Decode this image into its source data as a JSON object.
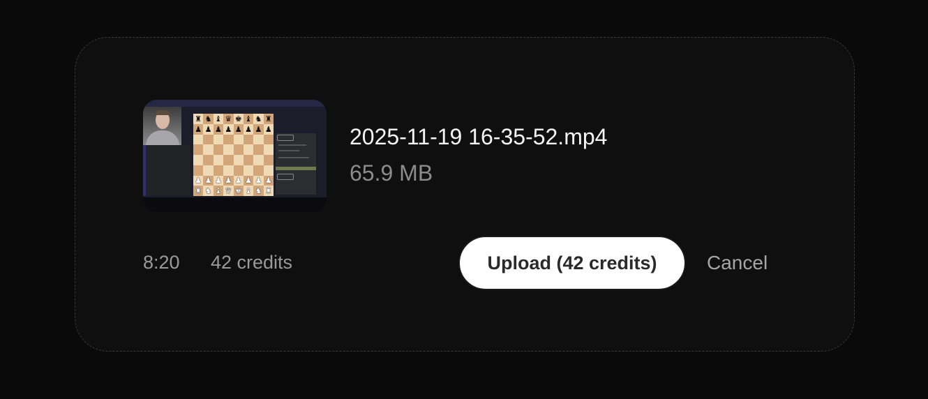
{
  "file": {
    "name": "2025-11-19 16-35-52.mp4",
    "size": "65.9 MB",
    "duration": "8:20",
    "credits": "42 credits",
    "thumbnail_icon": "chess-video-thumbnail"
  },
  "actions": {
    "upload_label": "Upload (42 credits)",
    "cancel_label": "Cancel"
  },
  "colors": {
    "background": "#0a0a0a",
    "card": "#0f0f0f",
    "primary_button_bg": "#ffffff",
    "primary_button_text": "#2a2a2a",
    "muted_text": "#9a9a9a"
  }
}
